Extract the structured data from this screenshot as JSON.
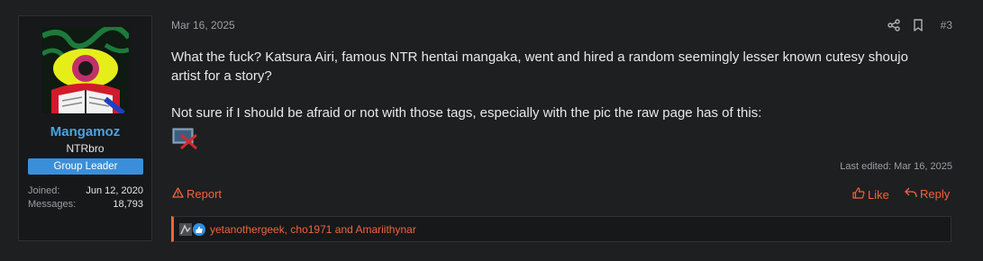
{
  "post": {
    "date": "Mar 16, 2025",
    "number": "#3",
    "paragraph1": "What the fuck? Katsura Airi, famous NTR hentai mangaka, went and hired a random seemingly lesser known cutesy shoujo artist for a story?",
    "paragraph2": "Not sure if I should be afraid or not with those tags, especially with the pic the raw page has of this:",
    "last_edited": "Last edited: Mar 16, 2025",
    "report_label": "Report",
    "like_label": "Like",
    "reply_label": "Reply",
    "reactions_users": "yetanothergeek, cho1971 and Amariithynar"
  },
  "user": {
    "name": "Mangamoz",
    "title": "NTRbro",
    "banner": "Group Leader",
    "joined_label": "Joined:",
    "joined_value": "Jun 12, 2020",
    "messages_label": "Messages:",
    "messages_value": "18,793"
  },
  "colors": {
    "accent": "#f0643c",
    "username": "#4aa3df",
    "banner": "#3a8fd8"
  },
  "icons": [
    "share-icon",
    "bookmark-icon",
    "warning-icon",
    "thumbs-up-icon",
    "reply-icon",
    "broken-image-icon",
    "like-reaction-icon"
  ]
}
